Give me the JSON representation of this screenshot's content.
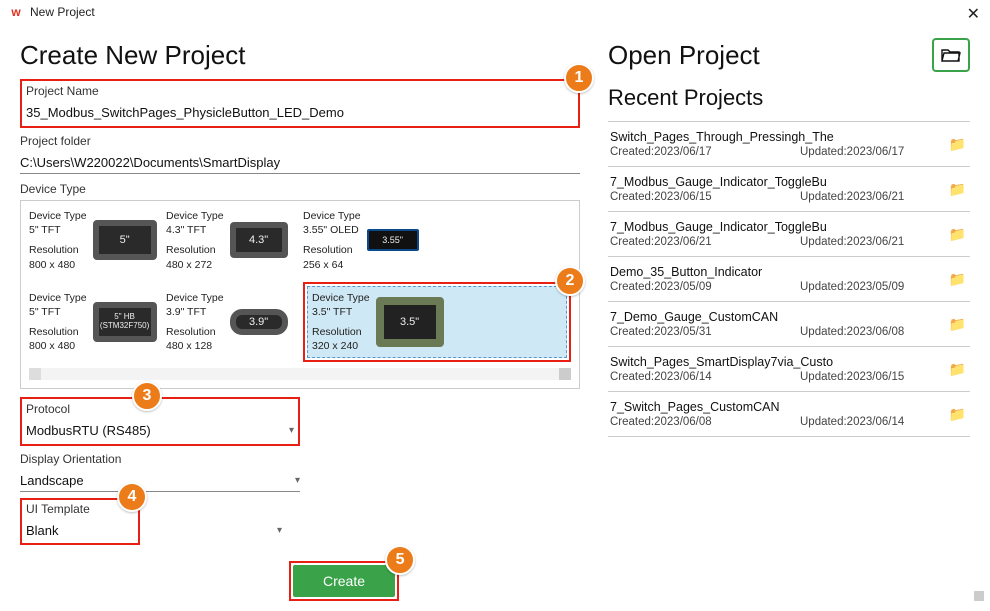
{
  "window": {
    "title": "New Project"
  },
  "left": {
    "heading": "Create New Project",
    "project_name_label": "Project Name",
    "project_name_value": "35_Modbus_SwitchPages_PhysicleButton_LED_Demo",
    "project_folder_label": "Project folder",
    "project_folder_value": "C:\\Users\\W220022\\Documents\\SmartDisplay",
    "device_type_label": "Device Type",
    "devices": [
      {
        "type_lbl": "Device Type",
        "type": "5\" TFT",
        "res_lbl": "Resolution",
        "res": "800 x 480",
        "chip": "5\""
      },
      {
        "type_lbl": "Device Type",
        "type": "4.3\" TFT",
        "res_lbl": "Resolution",
        "res": "480 x 272",
        "chip": "4.3\""
      },
      {
        "type_lbl": "Device Type",
        "type": "3.55\" OLED",
        "res_lbl": "Resolution",
        "res": "256 x 64",
        "chip": "3.55\""
      },
      {
        "type_lbl": "Device Type",
        "type": "5\" TFT",
        "res_lbl": "Resolution",
        "res": "800 x 480",
        "chip": "5\" HB",
        "chip2": "(STM32F750)"
      },
      {
        "type_lbl": "Device Type",
        "type": "3.9\" TFT",
        "res_lbl": "Resolution",
        "res": "480 x 128",
        "chip": "3.9\""
      },
      {
        "type_lbl": "Device Type",
        "type": "3.5\" TFT",
        "res_lbl": "Resolution",
        "res": "320 x 240",
        "chip": "3.5\""
      }
    ],
    "protocol_label": "Protocol",
    "protocol_value": "ModbusRTU (RS485)",
    "orientation_label": "Display Orientation",
    "orientation_value": "Landscape",
    "template_label": "UI Template",
    "template_value": "Blank",
    "create_label": "Create"
  },
  "right": {
    "open_heading": "Open Project",
    "recent_heading": "Recent Projects",
    "recent": [
      {
        "name": "Switch_Pages_Through_Pressingh_The",
        "created": "Created:2023/06/17",
        "updated": "Updated:2023/06/17"
      },
      {
        "name": "7_Modbus_Gauge_Indicator_ToggleBu",
        "created": "Created:2023/06/15",
        "updated": "Updated:2023/06/21"
      },
      {
        "name": "7_Modbus_Gauge_Indicator_ToggleBu",
        "created": "Created:2023/06/21",
        "updated": "Updated:2023/06/21"
      },
      {
        "name": "Demo_35_Button_Indicator",
        "created": "Created:2023/05/09",
        "updated": "Updated:2023/05/09"
      },
      {
        "name": "7_Demo_Gauge_CustomCAN",
        "created": "Created:2023/05/31",
        "updated": "Updated:2023/06/08"
      },
      {
        "name": "Switch_Pages_SmartDisplay7via_Custo",
        "created": "Created:2023/06/14",
        "updated": "Updated:2023/06/15"
      },
      {
        "name": "7_Switch_Pages_CustomCAN",
        "created": "Created:2023/06/08",
        "updated": "Updated:2023/06/14"
      }
    ]
  },
  "annotations": {
    "b1": "1",
    "b2": "2",
    "b3": "3",
    "b4": "4",
    "b5": "5"
  }
}
